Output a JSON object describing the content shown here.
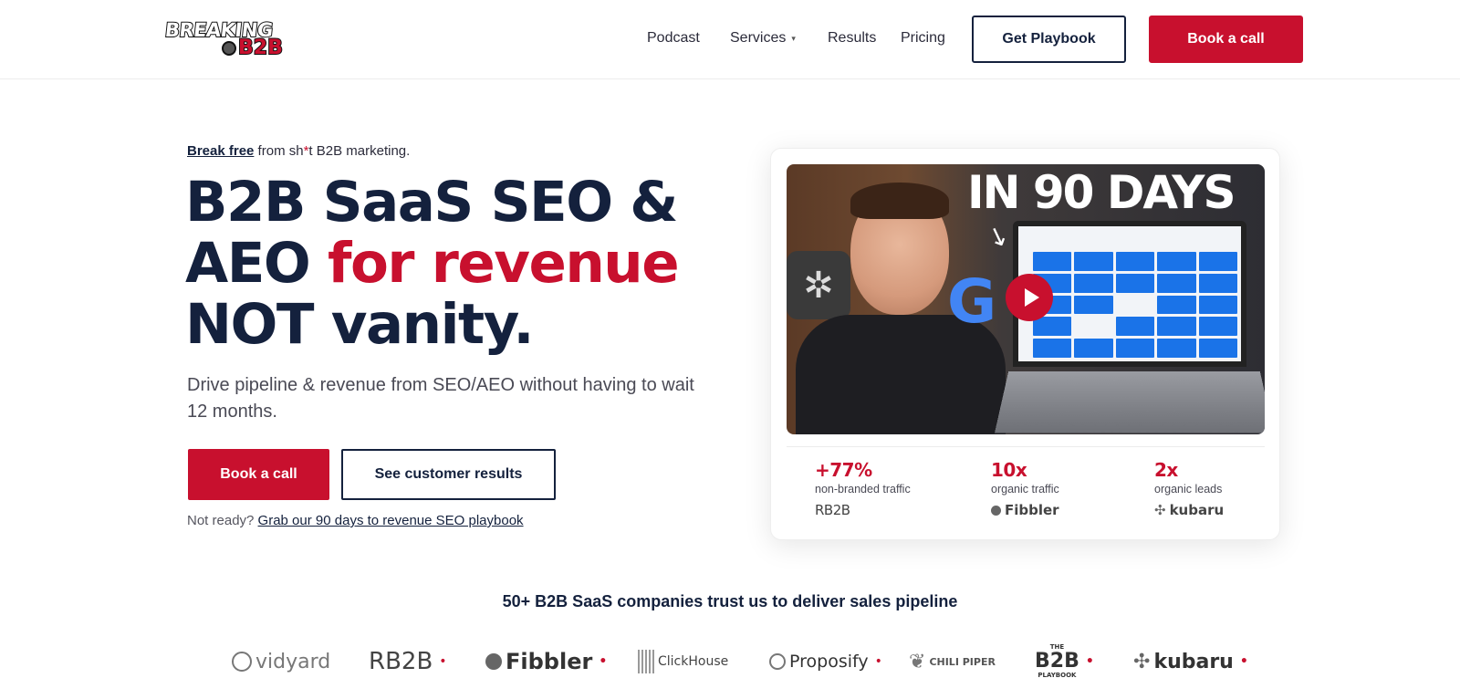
{
  "header": {
    "logo": {
      "line1": "BREAKING",
      "line2": "B2B"
    },
    "nav": [
      {
        "id": "podcast",
        "label": "Podcast"
      },
      {
        "id": "services",
        "label": "Services"
      },
      {
        "id": "results",
        "label": "Results"
      },
      {
        "id": "pricing",
        "label": "Pricing"
      }
    ],
    "get_playbook": "Get Playbook",
    "book_call": "Book a call"
  },
  "hero": {
    "eyebrow_link": "Break free",
    "eyebrow_pre": " from sh",
    "eyebrow_star": "*",
    "eyebrow_post": "t B2B marketing.",
    "headline_line1": "B2B SaaS SEO &",
    "headline_line2_a": "AEO ",
    "headline_line2_b": "for revenue",
    "headline_line3": "NOT vanity.",
    "subhead": "Drive pipeline & revenue from SEO/AEO without having to wait 12 months.",
    "cta_primary": "Book a call",
    "cta_secondary": "See customer results",
    "note_pre": "Not ready? ",
    "note_link": "Grab our 90 days to revenue SEO playbook"
  },
  "card": {
    "video_title": "IN 90 DAYS",
    "stats": [
      {
        "value": "+77%",
        "label": "non-branded traffic",
        "logo": "RB2B"
      },
      {
        "value": "10x",
        "label": "organic traffic",
        "logo": "Fibbler"
      },
      {
        "value": "2x",
        "label": "organic leads",
        "logo": "kubaru"
      }
    ]
  },
  "trust": {
    "title": "50+ B2B SaaS companies trust us to deliver sales pipeline",
    "logos": [
      "vidyard",
      "RB2B",
      "Fibbler",
      "ClickHouse",
      "Proposify",
      "CHILI PIPER",
      "B2B",
      "kubaru"
    ],
    "logo_sub": {
      "b2b_top": "THE",
      "b2b_bottom": "PLAYBOOK"
    }
  },
  "colors": {
    "navy": "#14213d",
    "red": "#c8102e"
  }
}
